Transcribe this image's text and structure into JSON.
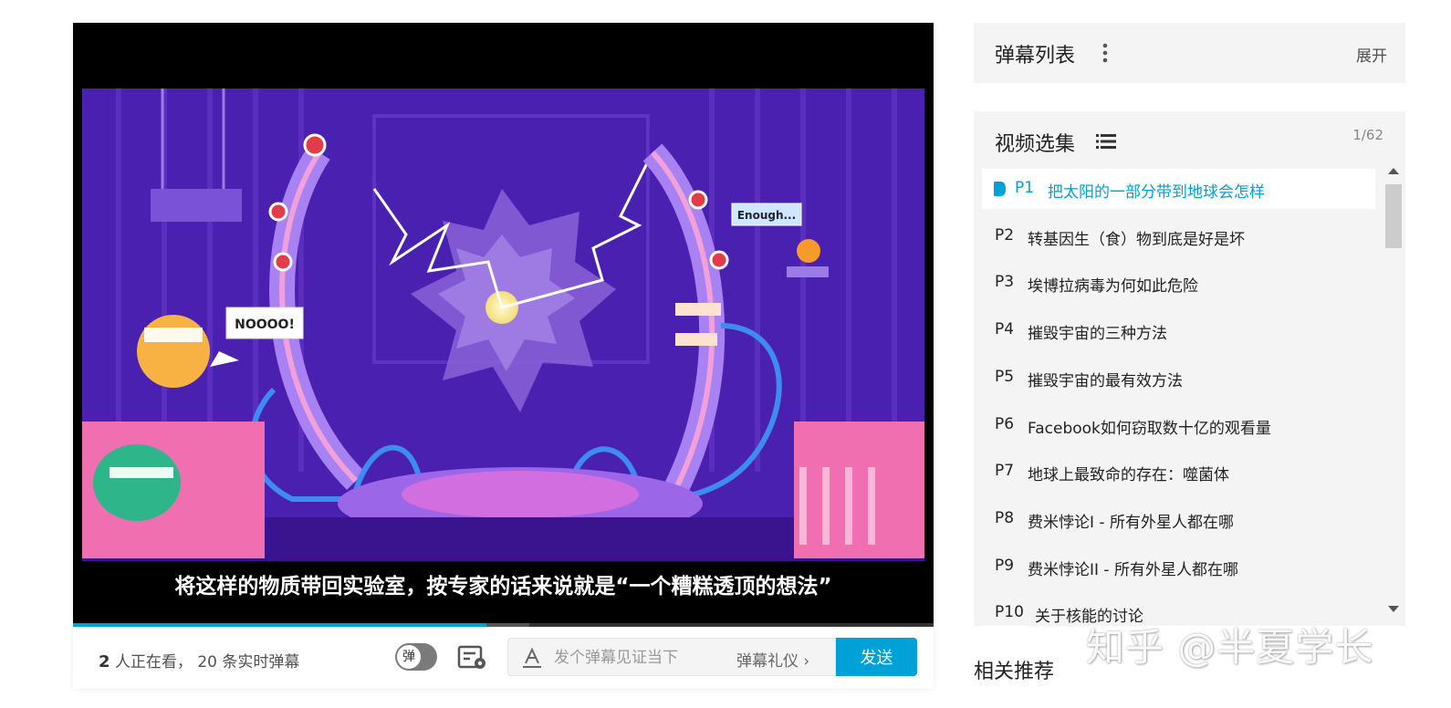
{
  "video": {
    "subtitle": "将这样的物质带回实验室，按专家的话来说就是“一个糟糕透顶的想法”",
    "bubble_left": "NOOOO!",
    "bubble_right": "Enough...",
    "progress_fraction": 0.48
  },
  "bar": {
    "viewer_count": "2",
    "viewers_text": "人正在看，",
    "danmaku_count_text": "20 条实时弹幕",
    "toggle_label": "弹",
    "input_placeholder": "发个弹幕见证当下",
    "etiquette_label": "弹幕礼仪",
    "send_label": "发送"
  },
  "sidebar": {
    "danmaku_list_title": "弹幕列表",
    "expand_label": "展开",
    "episodes_title": "视频选集",
    "episode_count": "1/62",
    "episodes": [
      {
        "num": "P1",
        "title": "把太阳的一部分带到地球会怎样",
        "active": true
      },
      {
        "num": "P2",
        "title": "转基因生（食）物到底是好是坏"
      },
      {
        "num": "P3",
        "title": "埃博拉病毒为何如此危险"
      },
      {
        "num": "P4",
        "title": "摧毁宇宙的三种方法"
      },
      {
        "num": "P5",
        "title": "摧毁宇宙的最有效方法"
      },
      {
        "num": "P6",
        "title": "Facebook如何窃取数十亿的观看量"
      },
      {
        "num": "P7",
        "title": "地球上最致命的存在：噬菌体"
      },
      {
        "num": "P8",
        "title": "费米悖论I - 所有外星人都在哪"
      },
      {
        "num": "P9",
        "title": "费米悖论II - 所有外星人都在哪"
      },
      {
        "num": "P10",
        "title": "关于核能的讨论"
      }
    ],
    "related_title": "相关推荐"
  },
  "watermark": "知乎 @半夏学长",
  "colors": {
    "accent": "#00a1d6",
    "panel": "#f4f4f4",
    "scene_bg": "#4a20b0"
  }
}
